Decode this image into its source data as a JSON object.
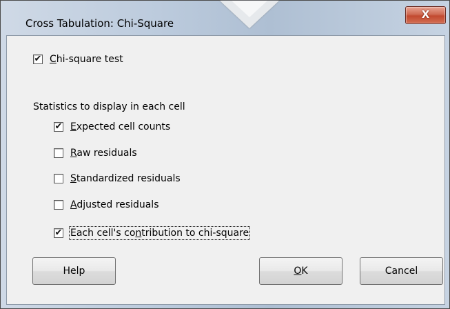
{
  "window": {
    "title": "Cross Tabulation: Chi-Square",
    "close_label": "X"
  },
  "chi_square_test": {
    "label_prefix": "",
    "mnemonic": "C",
    "label_rest": "hi-square test",
    "checked": true
  },
  "section": {
    "label": "Statistics to display in each cell"
  },
  "options": [
    {
      "mnemonic": "E",
      "rest": "xpected cell counts",
      "pre": "",
      "checked": true
    },
    {
      "mnemonic": "R",
      "rest": "aw residuals",
      "pre": "",
      "checked": false
    },
    {
      "mnemonic": "S",
      "rest": "tandardized residuals",
      "pre": "",
      "checked": false
    },
    {
      "mnemonic": "A",
      "rest": "djusted residuals",
      "pre": "",
      "checked": false
    },
    {
      "pre": "Each cell's co",
      "mnemonic": "n",
      "rest": "tribution to chi-square",
      "checked": true
    }
  ],
  "buttons": {
    "help": "Help",
    "ok_mnemonic": "O",
    "ok_rest": "K",
    "cancel": "Cancel"
  },
  "check_glyph": "✔"
}
